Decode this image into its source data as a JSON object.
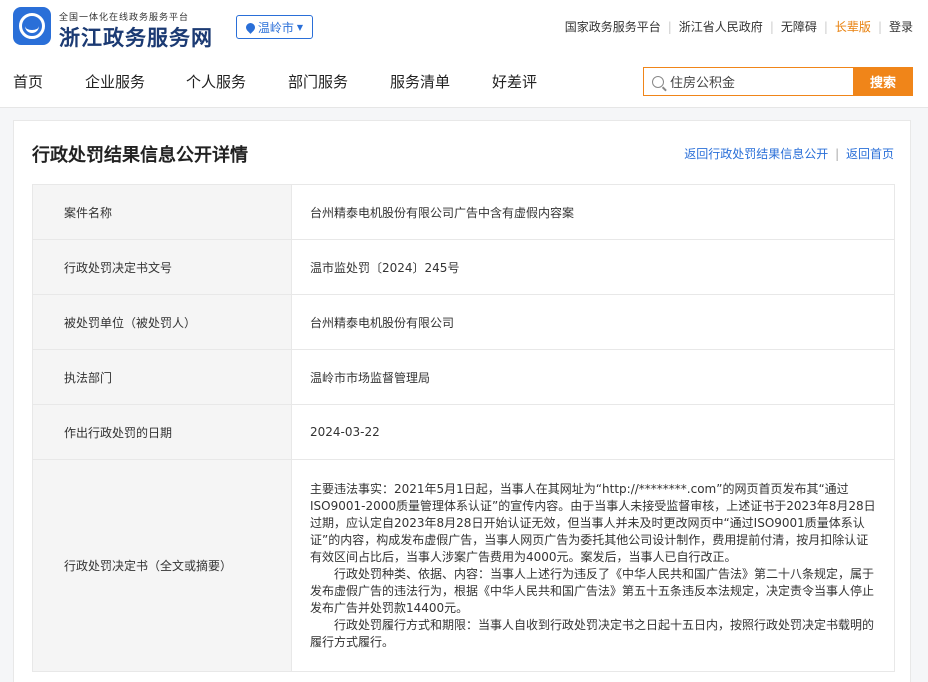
{
  "header": {
    "brand_sub": "全国一体化在线政务服务平台",
    "brand_main": "浙江政务服务网",
    "city": "温岭市",
    "links": [
      "国家政务服务平台",
      "浙江省人民政府",
      "无障碍",
      "长辈版",
      "登录"
    ],
    "accent_color": "#2a6fd8",
    "elder_color": "#e8800c"
  },
  "nav": {
    "items": [
      "首页",
      "企业服务",
      "个人服务",
      "部门服务",
      "服务清单",
      "好差评"
    ],
    "search_value": "住房公积金",
    "search_button": "搜索",
    "search_color": "#f08519"
  },
  "page": {
    "title": "行政处罚结果信息公开详情",
    "crumb_back": "返回行政处罚结果信息公开",
    "crumb_home": "返回首页"
  },
  "details": [
    {
      "label": "案件名称",
      "value": "台州精泰电机股份有限公司广告中含有虚假内容案"
    },
    {
      "label": "行政处罚决定书文号",
      "value": "温市监处罚〔2024〕245号"
    },
    {
      "label": "被处罚单位（被处罚人）",
      "value": "台州精泰电机股份有限公司"
    },
    {
      "label": "执法部门",
      "value": "温岭市市场监督管理局"
    },
    {
      "label": "作出行政处罚的日期",
      "value": "2024-03-22"
    },
    {
      "label": "行政处罚决定书（全文或摘要）",
      "paragraphs": [
        "主要违法事实：2021年5月1日起，当事人在其网址为“http://********.com”的网页首页发布其“通过ISO9001-2000质量管理体系认证”的宣传内容。由于当事人未接受监督审核，上述证书于2023年8月28日过期，应认定自2023年8月28日开始认证无效，但当事人并未及时更改网页中“通过ISO9001质量体系认证”的内容，构成发布虚假广告，当事人网页广告为委托其他公司设计制作，费用提前付清，按月扣除认证有效区间占比后，当事人涉案广告费用为4000元。案发后，当事人已自行改正。",
        "行政处罚种类、依据、内容：当事人上述行为违反了《中华人民共和国广告法》第二十八条规定，属于发布虚假广告的违法行为，根据《中华人民共和国广告法》第五十五条违反本法规定，决定责令当事人停止发布广告并处罚款14400元。",
        "行政处罚履行方式和期限：当事人自收到行政处罚决定书之日起十五日内，按照行政处罚决定书载明的履行方式履行。"
      ]
    }
  ]
}
